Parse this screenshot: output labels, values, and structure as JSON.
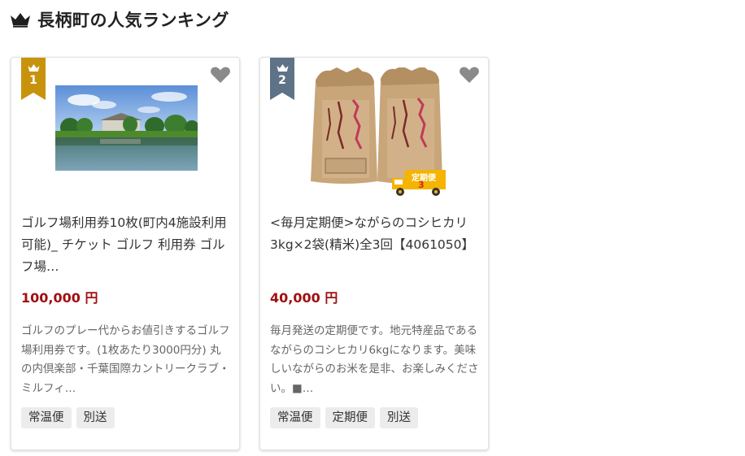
{
  "header": {
    "title": "長柄町の人気ランキング",
    "icon": "crown-icon"
  },
  "colors": {
    "gold": "#c8930c",
    "slate": "#5e7388",
    "price": "#a01010",
    "heart": "#8a8a8a",
    "truck": "#f5b400"
  },
  "ranking": [
    {
      "rank": "1",
      "name": "ゴルフ場利用券10枚(町内4施設利用可能)_ チケット ゴルフ 利用券 ゴルフ場…",
      "price": "100,000 円",
      "description": "ゴルフのプレー代からお値引きするゴルフ場利用券です。(1枚あたり3000円分) 丸の内倶楽部・千葉国際カントリークラブ・ミルフィ…",
      "tags": [
        "常温便",
        "別送"
      ]
    },
    {
      "rank": "2",
      "name": "<毎月定期便>ながらのコシヒカリ　3kg×2袋(精米)全3回【4061050】",
      "price": "40,000 円",
      "description": "毎月発送の定期便です。地元特産品であるながらのコシヒカリ6kgになります。美味しいながらのお米を是非、お楽しみください。■…",
      "tags": [
        "常温便",
        "定期便",
        "別送"
      ],
      "truck_label": "定期便",
      "truck_count": "3"
    }
  ]
}
